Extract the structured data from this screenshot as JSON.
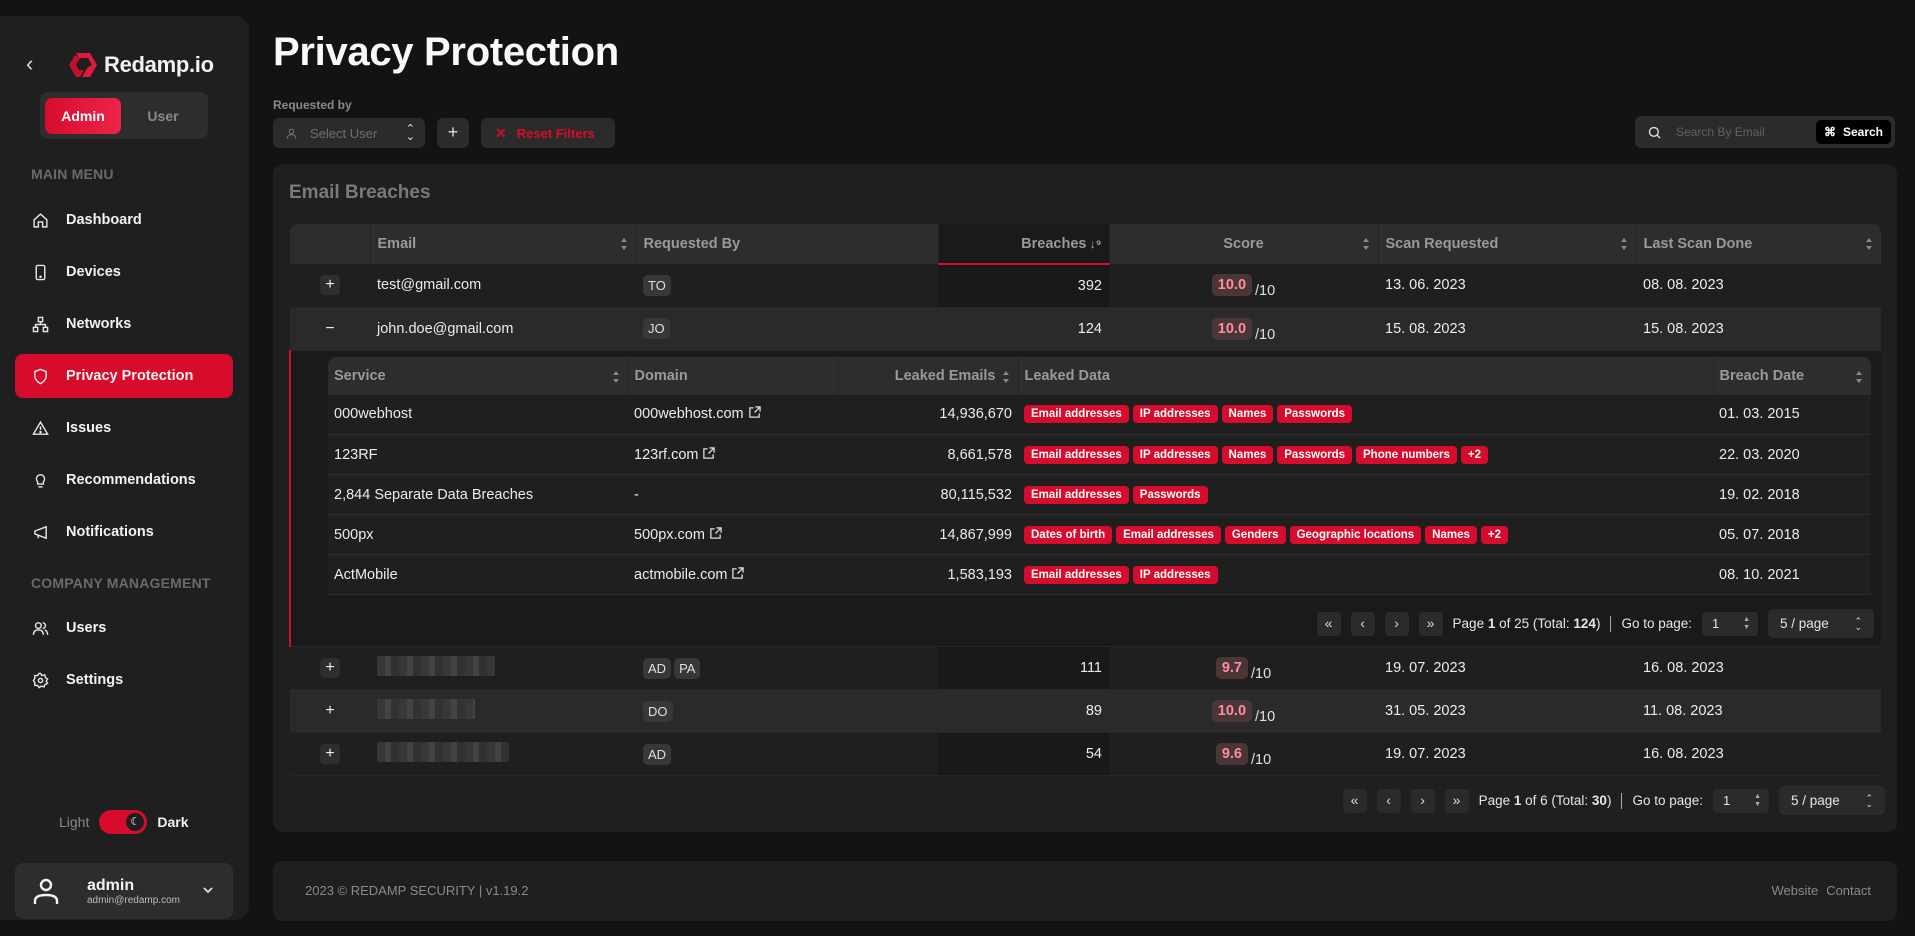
{
  "brand": {
    "name": "Redamp.io",
    "accent": "#d70c2c"
  },
  "role_toggle": {
    "options": [
      "Admin",
      "User"
    ],
    "selected": "Admin"
  },
  "sidebar": {
    "main_menu_title": "MAIN MENU",
    "main_items": [
      {
        "label": "Dashboard",
        "icon": "home-icon"
      },
      {
        "label": "Devices",
        "icon": "device-icon"
      },
      {
        "label": "Networks",
        "icon": "network-icon"
      },
      {
        "label": "Privacy Protection",
        "icon": "shield-icon",
        "active": true
      },
      {
        "label": "Issues",
        "icon": "warning-icon"
      },
      {
        "label": "Recommendations",
        "icon": "lightbulb-icon"
      },
      {
        "label": "Notifications",
        "icon": "megaphone-icon"
      }
    ],
    "company_title": "COMPANY MANAGEMENT",
    "company_items": [
      {
        "label": "Users",
        "icon": "users-icon"
      },
      {
        "label": "Settings",
        "icon": "gear-icon"
      }
    ],
    "theme": {
      "light_label": "Light",
      "dark_label": "Dark",
      "selected": "Dark"
    },
    "user": {
      "name": "admin",
      "email": "admin@redamp.com"
    }
  },
  "page": {
    "title": "Privacy Protection",
    "filters": {
      "requested_by_label": "Requested by",
      "select_user_placeholder": "Select User",
      "add_label": "+",
      "reset_label": "Reset Filters"
    },
    "search": {
      "placeholder": "Search By Email",
      "button_label": "Search",
      "shortcut": "⌘"
    }
  },
  "breaches": {
    "title": "Email Breaches",
    "columns": [
      "",
      "Email",
      "Requested By",
      "Breaches",
      "Score",
      "Scan Requested",
      "Last Scan Done"
    ],
    "rows": [
      {
        "email": "test@gmail.com",
        "requested_by": [
          "TO"
        ],
        "breaches": "392",
        "score": "10.0",
        "score_max": "/10",
        "scan_requested": "13. 06. 2023",
        "last_scan": "08. 08. 2023",
        "expanded": false,
        "redacted": false
      },
      {
        "email": "john.doe@gmail.com",
        "requested_by": [
          "JO"
        ],
        "breaches": "124",
        "score": "10.0",
        "score_max": "/10",
        "scan_requested": "15. 08. 2023",
        "last_scan": "15. 08. 2023",
        "expanded": true,
        "redacted": false
      },
      {
        "email": "",
        "requested_by": [
          "AD",
          "PA"
        ],
        "breaches": "111",
        "score": "9.7",
        "score_max": "/10",
        "scan_requested": "19. 07. 2023",
        "last_scan": "16. 08. 2023",
        "expanded": false,
        "redacted": true
      },
      {
        "email": "",
        "requested_by": [
          "DO"
        ],
        "breaches": "89",
        "score": "10.0",
        "score_max": "/10",
        "scan_requested": "31. 05. 2023",
        "last_scan": "11. 08. 2023",
        "expanded": false,
        "redacted": true
      },
      {
        "email": "",
        "requested_by": [
          "AD"
        ],
        "breaches": "54",
        "score": "9.6",
        "score_max": "/10",
        "scan_requested": "19. 07. 2023",
        "last_scan": "16. 08. 2023",
        "expanded": false,
        "redacted": true
      }
    ],
    "detail": {
      "columns": [
        "Service",
        "Domain",
        "Leaked Emails",
        "Leaked Data",
        "Breach Date"
      ],
      "rows": [
        {
          "service": "000webhost",
          "domain": "000webhost.com",
          "has_link": true,
          "leaked_emails": "14,936,670",
          "leaked_data": [
            "Email addresses",
            "IP addresses",
            "Names",
            "Passwords"
          ],
          "breach_date": "01. 03. 2015"
        },
        {
          "service": "123RF",
          "domain": "123rf.com",
          "has_link": true,
          "leaked_emails": "8,661,578",
          "leaked_data": [
            "Email addresses",
            "IP addresses",
            "Names",
            "Passwords",
            "Phone numbers",
            "+2"
          ],
          "breach_date": "22. 03. 2020"
        },
        {
          "service": "2,844 Separate Data Breaches",
          "domain": "-",
          "has_link": false,
          "leaked_emails": "80,115,532",
          "leaked_data": [
            "Email addresses",
            "Passwords"
          ],
          "breach_date": "19. 02. 2018"
        },
        {
          "service": "500px",
          "domain": "500px.com",
          "has_link": true,
          "leaked_emails": "14,867,999",
          "leaked_data": [
            "Dates of birth",
            "Email addresses",
            "Genders",
            "Geographic locations",
            "Names",
            "+2"
          ],
          "breach_date": "05. 07. 2018"
        },
        {
          "service": "ActMobile",
          "domain": "actmobile.com",
          "has_link": true,
          "leaked_emails": "1,583,193",
          "leaked_data": [
            "Email addresses",
            "IP addresses"
          ],
          "breach_date": "08. 10. 2021"
        }
      ],
      "pagination": {
        "page": "1",
        "of": "25",
        "total": "124",
        "goto_label": "Go to page:",
        "goto_value": "1",
        "per_page": "5 / page"
      }
    },
    "pagination": {
      "page": "1",
      "of": "6",
      "total": "30",
      "goto_label": "Go to page:",
      "goto_value": "1",
      "per_page": "5 / page"
    }
  },
  "footer": {
    "copyright": "2023 © REDAMP SECURITY | v1.19.2",
    "links": [
      "Website",
      "Contact"
    ]
  }
}
